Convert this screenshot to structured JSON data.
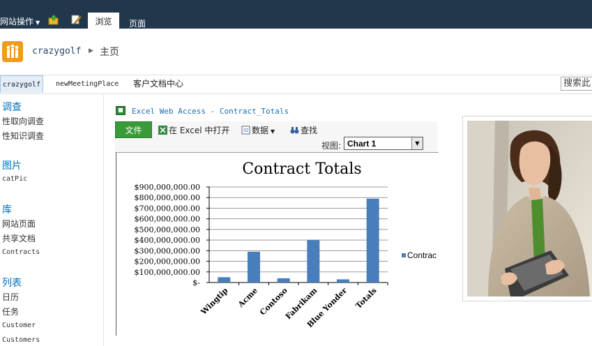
{
  "ribbon": {
    "site_actions": "网站操作",
    "tabs": [
      {
        "label": "浏览",
        "active": true
      },
      {
        "label": "页面",
        "active": false
      }
    ]
  },
  "title_bar": {
    "site_name": "crazygolf",
    "page_name": "主页"
  },
  "top_nav": {
    "items": [
      {
        "label": "crazygolf",
        "selected": true
      },
      {
        "label": "newMeetingPlace",
        "selected": false
      },
      {
        "label": "客户文档中心",
        "selected": false
      }
    ],
    "search_text": "搜索此"
  },
  "quick_launch": {
    "sections": [
      {
        "heading": "调查",
        "items": [
          "性取向调查",
          "性知识调查"
        ]
      },
      {
        "heading": "图片",
        "items": [
          "catPic"
        ]
      },
      {
        "heading": "库",
        "items": [
          "网站页面",
          "共享文档",
          "Contracts"
        ]
      },
      {
        "heading": "列表",
        "items": [
          "日历",
          "任务",
          "Customer",
          "Customers"
        ]
      }
    ]
  },
  "web_part": {
    "title": "Excel Web Access - Contract_Totals",
    "toolbar": {
      "file_label": "文件",
      "open_excel_label": "在 Excel 中打开",
      "data_label": "数据",
      "find_label": "查找",
      "view_label": "视图:",
      "view_value": "Chart 1"
    }
  },
  "colors": {
    "ribbon_bg": "#21374c",
    "bar": "#4a7ebb",
    "link": "#0072bc",
    "file_button": "#3a9b3a"
  },
  "chart_data": {
    "type": "bar",
    "title": "Contract Totals",
    "categories": [
      "Wingtip",
      "Acme",
      "Contoso",
      "Fabrikam",
      "Blue Yonder",
      "Totals"
    ],
    "series": [
      {
        "name": "Contrac",
        "values": [
          50000000,
          290000000,
          40000000,
          400000000,
          30000000,
          790000000
        ]
      }
    ],
    "ylim": [
      0,
      900000000
    ],
    "y_ticks": [
      "$-",
      "$100,000,000.00",
      "$200,000,000.00",
      "$300,000,000.00",
      "$400,000,000.00",
      "$500,000,000.00",
      "$600,000,000.00",
      "$700,000,000.00",
      "$800,000,000.00",
      "$900,000,000.00"
    ],
    "grid": true,
    "legend": "right"
  }
}
